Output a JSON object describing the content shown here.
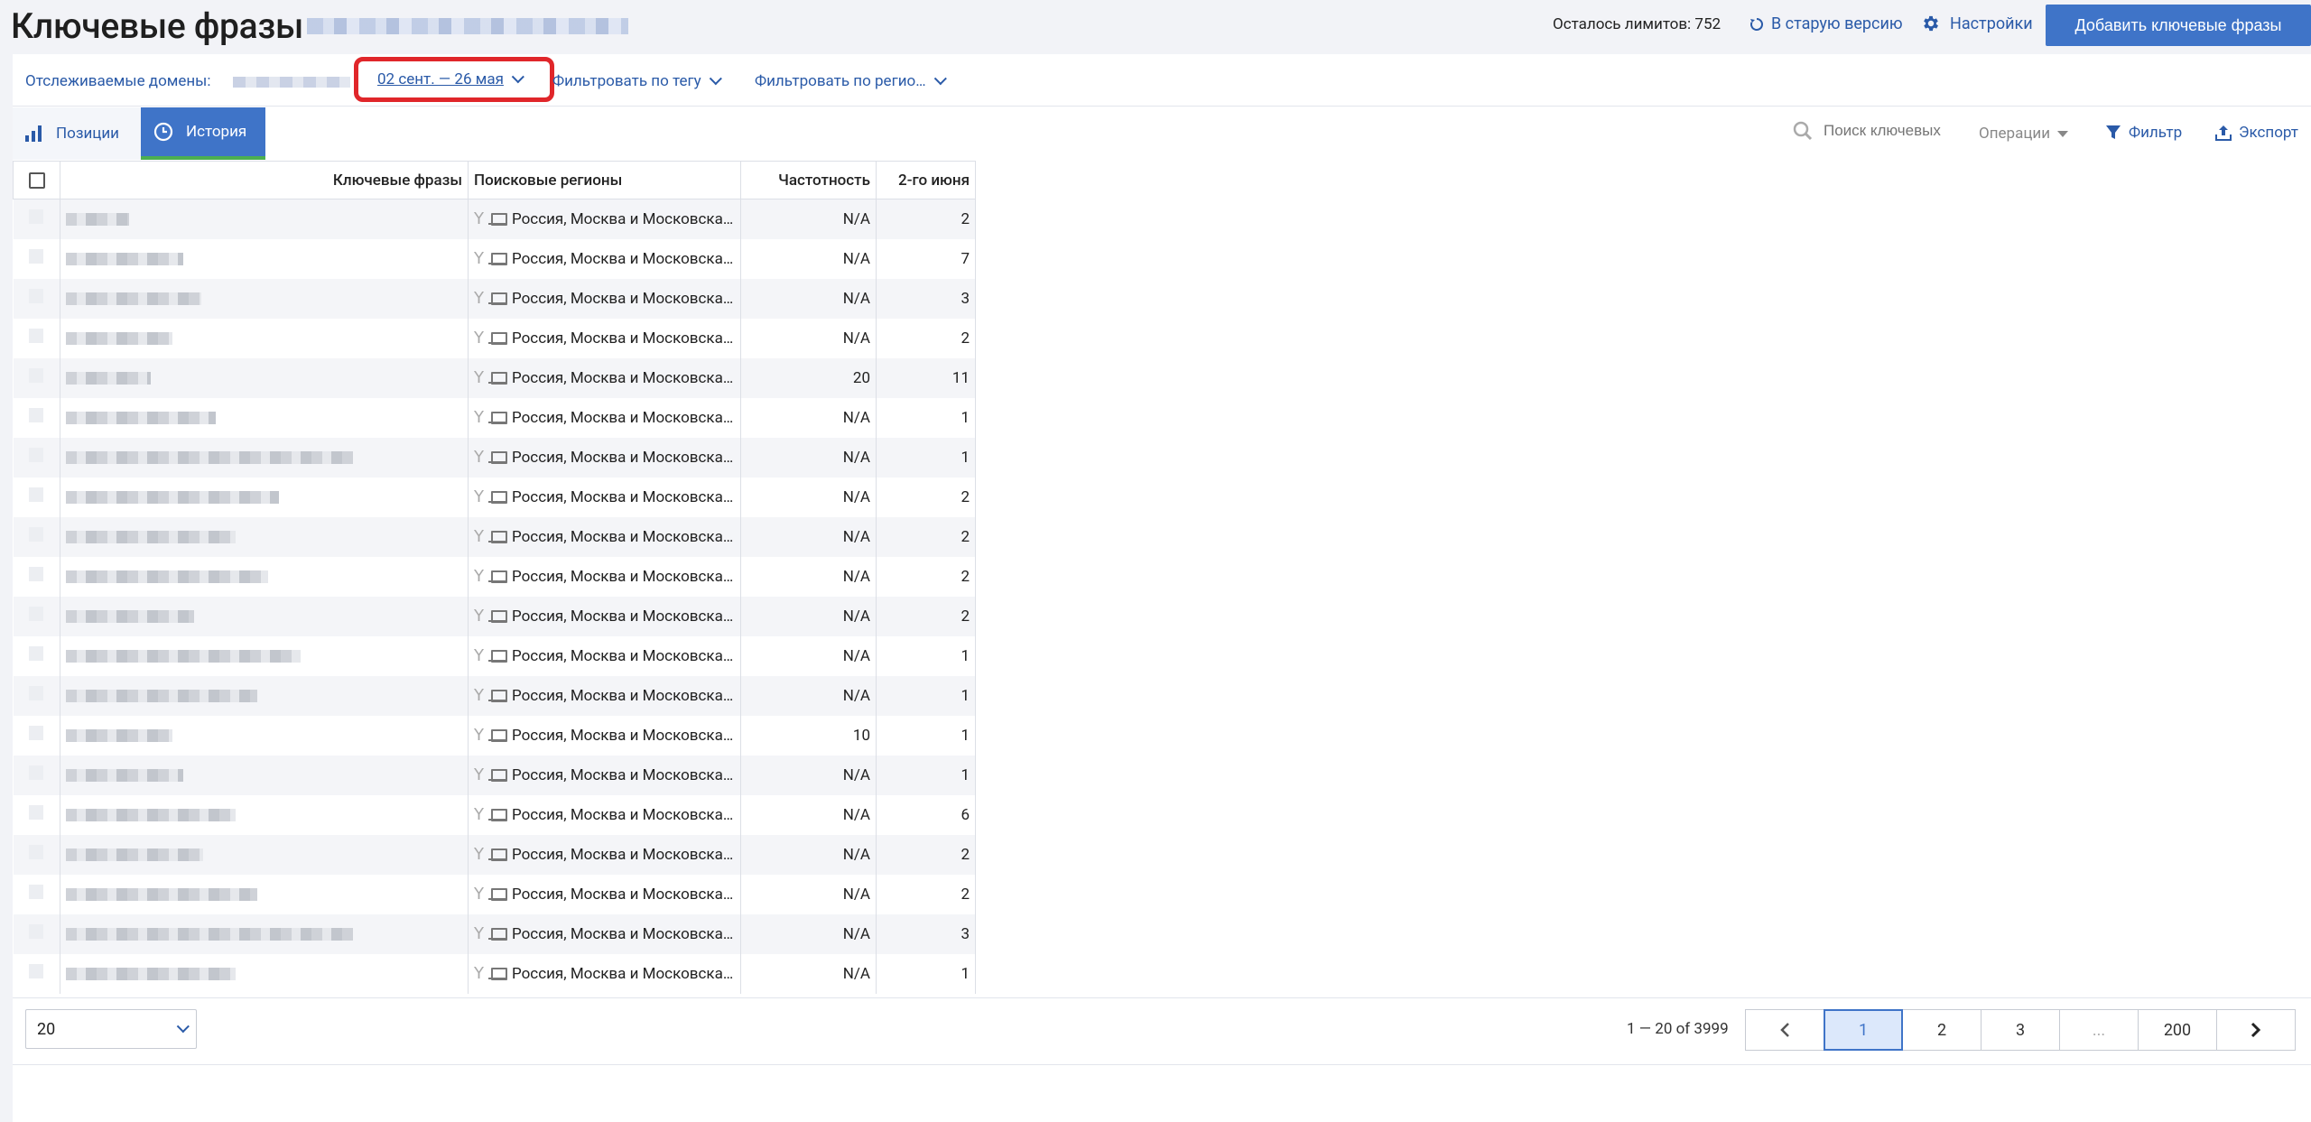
{
  "header": {
    "title": "Ключевые фразы",
    "limits": "Осталось лимитов: 752",
    "old_version": "В старую версию",
    "settings": "Настройки",
    "add_button": "Добавить ключевые фразы"
  },
  "filters": {
    "domains_label": "Отслеживаемые домены:",
    "date_range": "02 сент. — 26 мая",
    "tag_filter": "Фильтровать по тегу",
    "region_filter": "Фильтровать по регио…"
  },
  "tabs": [
    {
      "label": "Позиции"
    },
    {
      "label": "История"
    }
  ],
  "toolbar": {
    "search_placeholder": "Поиск ключевых",
    "operations": "Операции",
    "filter": "Фильтр",
    "export": "Экспорт"
  },
  "table": {
    "columns": [
      "Ключевые фразы",
      "Поисковые регионы",
      "Частотность",
      "2-го июня"
    ],
    "rows": [
      {
        "region": "Россия, Москва и Московская область",
        "freq": "N/A",
        "val": "2"
      },
      {
        "region": "Россия, Москва и Московская область",
        "freq": "N/A",
        "val": "7"
      },
      {
        "region": "Россия, Москва и Московская область",
        "freq": "N/A",
        "val": "3"
      },
      {
        "region": "Россия, Москва и Московская область",
        "freq": "N/A",
        "val": "2"
      },
      {
        "region": "Россия, Москва и Московская область",
        "freq": "20",
        "val": "11"
      },
      {
        "region": "Россия, Москва и Московская область",
        "freq": "N/A",
        "val": "1"
      },
      {
        "region": "Россия, Москва и Московская область",
        "freq": "N/A",
        "val": "1"
      },
      {
        "region": "Россия, Москва и Московская область",
        "freq": "N/A",
        "val": "2"
      },
      {
        "region": "Россия, Москва и Московская область",
        "freq": "N/A",
        "val": "2"
      },
      {
        "region": "Россия, Москва и Московская область",
        "freq": "N/A",
        "val": "2"
      },
      {
        "region": "Россия, Москва и Московская область",
        "freq": "N/A",
        "val": "2"
      },
      {
        "region": "Россия, Москва и Московская область",
        "freq": "N/A",
        "val": "1"
      },
      {
        "region": "Россия, Москва и Московская область",
        "freq": "N/A",
        "val": "1"
      },
      {
        "region": "Россия, Москва и Московская область",
        "freq": "10",
        "val": "1"
      },
      {
        "region": "Россия, Москва и Московская область",
        "freq": "N/A",
        "val": "1"
      },
      {
        "region": "Россия, Москва и Московская область",
        "freq": "N/A",
        "val": "6"
      },
      {
        "region": "Россия, Москва и Московская область",
        "freq": "N/A",
        "val": "2"
      },
      {
        "region": "Россия, Москва и Московская область",
        "freq": "N/A",
        "val": "2"
      },
      {
        "region": "Россия, Москва и Московская область",
        "freq": "N/A",
        "val": "3"
      },
      {
        "region": "Россия, Москва и Московская область",
        "freq": "N/A",
        "val": "1"
      }
    ]
  },
  "pagination": {
    "per_page": "20",
    "range": "1 — 20 of 3999",
    "pages": [
      "1",
      "2",
      "3",
      "...",
      "200"
    ]
  },
  "colors": {
    "accent": "#3f74c8",
    "link": "#2a5aa8",
    "highlight": "#e0262a",
    "active_tab_underline": "#4caf50"
  }
}
